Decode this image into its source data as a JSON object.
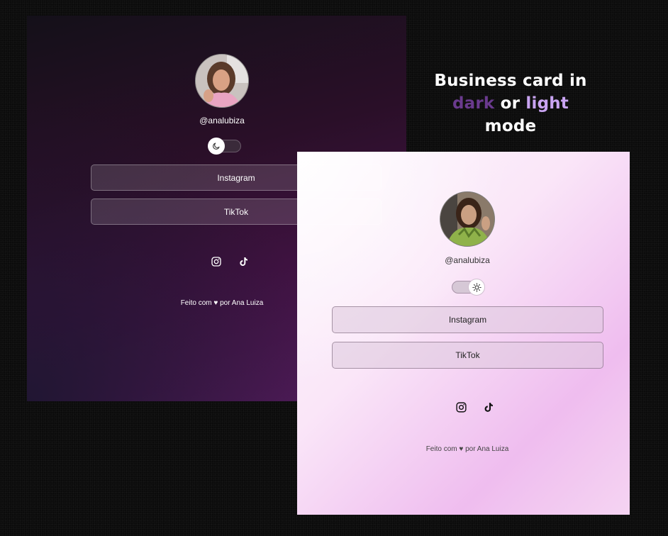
{
  "headline": {
    "line1": "Business card in",
    "word_dark": "dark",
    "word_or": "or",
    "word_light": "light",
    "word_mode": "mode",
    "colors": {
      "dark_word": "#6a3a8e",
      "light_word": "#c9a4f2"
    }
  },
  "dark_card": {
    "theme": "dark",
    "username": "@analubiza",
    "theme_toggle": {
      "state": "dark",
      "icon": "moon-icon"
    },
    "buttons": [
      {
        "label": "Instagram"
      },
      {
        "label": "TikTok"
      }
    ],
    "social_icons": [
      "instagram-icon",
      "tiktok-icon"
    ],
    "footer": {
      "prefix": "Feito com",
      "heart": "♥",
      "suffix": "por Ana Luiza"
    }
  },
  "light_card": {
    "theme": "light",
    "username": "@analubiza",
    "theme_toggle": {
      "state": "light",
      "icon": "sun-icon"
    },
    "buttons": [
      {
        "label": "Instagram"
      },
      {
        "label": "TikTok"
      }
    ],
    "social_icons": [
      "instagram-icon",
      "tiktok-icon"
    ],
    "footer": {
      "prefix": "Feito com",
      "heart": "♥",
      "suffix": "por Ana Luiza"
    }
  }
}
